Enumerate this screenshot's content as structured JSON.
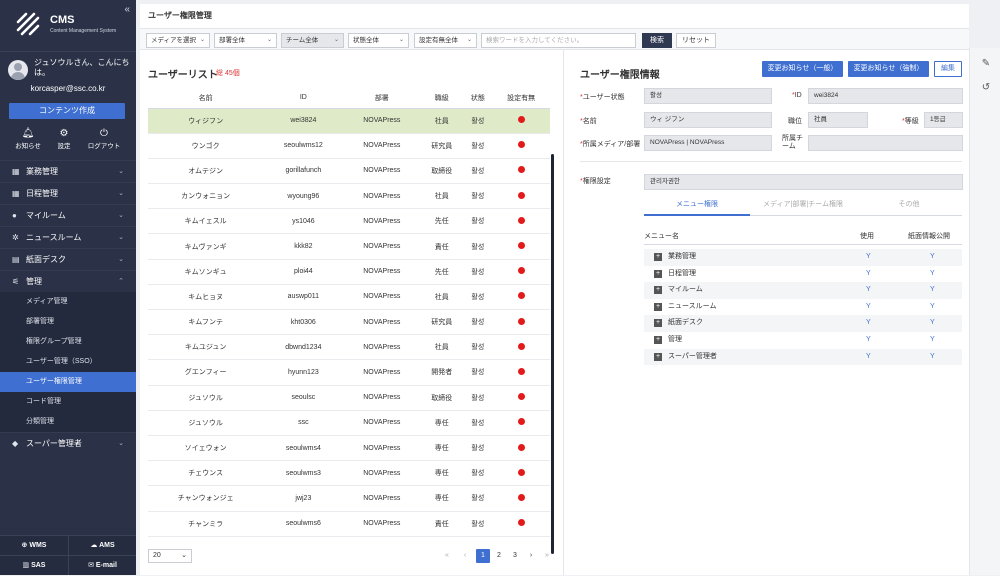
{
  "sidebar": {
    "app": "CMS",
    "app_sub": "Content Management System",
    "collapse": "«",
    "greeting": "ジュソウルさん、こんにちは。",
    "email": "korcasper@ssc.co.kr",
    "create_button": "コンテンツ作成",
    "quick": [
      {
        "label": "お知らせ",
        "icon": "bell-icon"
      },
      {
        "label": "設定",
        "icon": "gear-icon"
      },
      {
        "label": "ログアウト",
        "icon": "power-icon"
      }
    ],
    "menu": [
      {
        "label": "業務管理",
        "icon": "calendar-icon"
      },
      {
        "label": "日程管理",
        "icon": "grid-icon"
      },
      {
        "label": "マイルーム",
        "icon": "person-icon"
      },
      {
        "label": "ニュースルーム",
        "icon": "gear-icon"
      },
      {
        "label": "紙面デスク",
        "icon": "newspaper-icon"
      },
      {
        "label": "管理",
        "icon": "sliders-icon"
      }
    ],
    "submenu": [
      "メディア管理",
      "部署管理",
      "権限グループ管理",
      "ユーザー管理（SSO）",
      "ユーザー権限管理",
      "コード管理",
      "分類管理"
    ],
    "super_admin": "スーパー管理者",
    "bottom": [
      "WMS",
      "AMS",
      "SAS",
      "E-mail"
    ]
  },
  "page": {
    "title": "ユーザー権限管理"
  },
  "filters": {
    "media": "メディアを選択",
    "dept": "部署全体",
    "team": "チーム全体",
    "status": "状態全体",
    "config": "設定有無全体",
    "search_placeholder": "検索ワードを入力してください。",
    "search_button": "検索",
    "reset_button": "リセット"
  },
  "list": {
    "title": "ユーザーリスト",
    "count": "総 45個",
    "headers": [
      "名前",
      "ID",
      "部署",
      "職級",
      "状態",
      "設定有無"
    ],
    "rows": [
      [
        "ウィジフン",
        "wei3824",
        "NOVAPress",
        "社員",
        "활성"
      ],
      [
        "ウンゴク",
        "seoulwms12",
        "NOVAPress",
        "研究員",
        "활성"
      ],
      [
        "オムテジン",
        "gorillafunch",
        "NOVAPress",
        "取締役",
        "활성"
      ],
      [
        "カンウォニョン",
        "wyoung96",
        "NOVAPress",
        "社員",
        "활성"
      ],
      [
        "キムイェスル",
        "ys1046",
        "NOVAPress",
        "先任",
        "활성"
      ],
      [
        "キムヴァンギ",
        "kkk82",
        "NOVAPress",
        "責任",
        "활성"
      ],
      [
        "キムソンギュ",
        "ploi44",
        "NOVAPress",
        "先任",
        "활성"
      ],
      [
        "キムヒョヌ",
        "auswp011",
        "NOVAPress",
        "社員",
        "활성"
      ],
      [
        "キムフンテ",
        "kht0306",
        "NOVAPress",
        "研究員",
        "활성"
      ],
      [
        "キムユジュン",
        "dbwnd1234",
        "NOVAPress",
        "社員",
        "활성"
      ],
      [
        "グエンフィー",
        "hyunn123",
        "NOVAPress",
        "開発者",
        "활성"
      ],
      [
        "ジュソウル",
        "seoulsc",
        "NOVAPress",
        "取締役",
        "활성"
      ],
      [
        "ジュソウル",
        "ssc",
        "NOVAPress",
        "専任",
        "활성"
      ],
      [
        "ソイェウォン",
        "seoulwms4",
        "NOVAPress",
        "専任",
        "활성"
      ],
      [
        "チェウンス",
        "seoulwms3",
        "NOVAPress",
        "専任",
        "활성"
      ],
      [
        "チャンウォンジェ",
        "jwj23",
        "NOVAPress",
        "専任",
        "활성"
      ],
      [
        "チャンミラ",
        "seoulwms6",
        "NOVAPress",
        "責任",
        "활성"
      ]
    ],
    "page_size": "20",
    "pages": [
      "1",
      "2",
      "3"
    ],
    "nav": [
      "«",
      "‹",
      "›",
      "»"
    ]
  },
  "detail": {
    "title": "ユーザー権限情報",
    "buttons": [
      "変更お知らせ（一般）",
      "変更お知らせ（強制）",
      "編集"
    ],
    "labels": {
      "status": "ユーザー状態",
      "id": "ID",
      "name": "名前",
      "position": "職位",
      "grade": "等級",
      "media": "所属メディア/部署",
      "team": "所属チーム",
      "perm": "権限設定"
    },
    "values": {
      "status": "활성",
      "id": "wei3824",
      "name": "ウィ ジフン",
      "position": "社員",
      "grade": "1등급",
      "media": "NOVAPress | NOVAPress",
      "team": "",
      "perm": "관리자권한"
    },
    "required_mark": "*",
    "tabs": [
      "メニュー権限",
      "メディア|部署|チーム権限",
      "その他"
    ],
    "menu_headers": [
      "メニュー名",
      "使用",
      "紙面情報公開"
    ],
    "menu_rows": [
      {
        "name": "業務管理",
        "use": "Y",
        "pub": "Y"
      },
      {
        "name": "日程管理",
        "use": "Y",
        "pub": "Y"
      },
      {
        "name": "マイルーム",
        "use": "Y",
        "pub": "Y"
      },
      {
        "name": "ニュースルーム",
        "use": "Y",
        "pub": "Y"
      },
      {
        "name": "紙面デスク",
        "use": "Y",
        "pub": "Y"
      },
      {
        "name": "管理",
        "use": "Y",
        "pub": "Y"
      },
      {
        "name": "スーパー管理者",
        "use": "Y",
        "pub": "Y"
      }
    ],
    "expand_symbol": "+"
  },
  "colors": {
    "accent": "#3e6fd1",
    "sidebar": "#2b3247",
    "selected_row": "#dfeac8",
    "dot": "#e31a1a"
  }
}
